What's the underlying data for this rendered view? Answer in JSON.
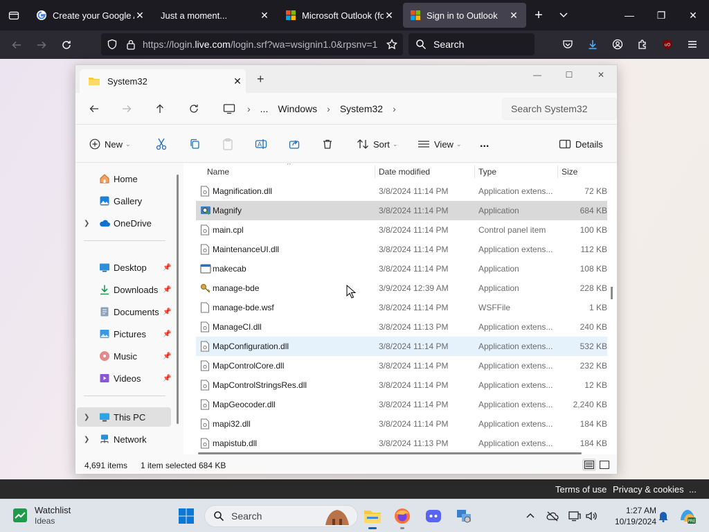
{
  "browser": {
    "tabs": [
      {
        "title": "Create your Google Account",
        "active": false
      },
      {
        "title": "Just a moment...",
        "active": false
      },
      {
        "title": "Microsoft Outlook (formerly Hotmail)",
        "active": false
      },
      {
        "title": "Sign in to Outlook",
        "active": true
      }
    ],
    "url_prefix": "https://login.",
    "url_domain": "live.com",
    "url_suffix": "/login.srf?wa=wsignin1.0&rpsnv=1",
    "search_placeholder": "Search",
    "footer_links": [
      "Terms of use",
      "Privacy & cookies",
      "..."
    ]
  },
  "explorer": {
    "tab_title": "System32",
    "breadcrumbs": [
      "...",
      "Windows",
      "System32"
    ],
    "search_placeholder": "Search System32",
    "toolbar": {
      "new_label": "New",
      "sort_label": "Sort",
      "view_label": "View",
      "more_label": "...",
      "details_label": "Details"
    },
    "nav": {
      "home": "Home",
      "gallery": "Gallery",
      "onedrive": "OneDrive",
      "desktop": "Desktop",
      "downloads": "Downloads",
      "documents": "Documents",
      "pictures": "Pictures",
      "music": "Music",
      "videos": "Videos",
      "this_pc": "This PC",
      "network": "Network"
    },
    "columns": {
      "name": "Name",
      "date": "Date modified",
      "type": "Type",
      "size": "Size"
    },
    "files": [
      {
        "name": "Magnification.dll",
        "date": "3/8/2024 11:14 PM",
        "type": "Application extens...",
        "size": "72 KB",
        "icon": "dll-icon"
      },
      {
        "name": "Magnify",
        "date": "3/8/2024 11:14 PM",
        "type": "Application",
        "size": "684 KB",
        "icon": "magnifier-app-icon"
      },
      {
        "name": "main.cpl",
        "date": "3/8/2024 11:14 PM",
        "type": "Control panel item",
        "size": "100 KB",
        "icon": "cpl-icon"
      },
      {
        "name": "MaintenanceUI.dll",
        "date": "3/8/2024 11:14 PM",
        "type": "Application extens...",
        "size": "112 KB",
        "icon": "dll-icon"
      },
      {
        "name": "makecab",
        "date": "3/8/2024 11:14 PM",
        "type": "Application",
        "size": "108 KB",
        "icon": "exe-icon"
      },
      {
        "name": "manage-bde",
        "date": "3/9/2024 12:39 AM",
        "type": "Application",
        "size": "228 KB",
        "icon": "keys-app-icon"
      },
      {
        "name": "manage-bde.wsf",
        "date": "3/8/2024 11:14 PM",
        "type": "WSFFile",
        "size": "1 KB",
        "icon": "blank-file-icon"
      },
      {
        "name": "ManageCI.dll",
        "date": "3/8/2024 11:13 PM",
        "type": "Application extens...",
        "size": "240 KB",
        "icon": "dll-icon"
      },
      {
        "name": "MapConfiguration.dll",
        "date": "3/8/2024 11:14 PM",
        "type": "Application extens...",
        "size": "532 KB",
        "icon": "dll-icon"
      },
      {
        "name": "MapControlCore.dll",
        "date": "3/8/2024 11:14 PM",
        "type": "Application extens...",
        "size": "232 KB",
        "icon": "dll-icon"
      },
      {
        "name": "MapControlStringsRes.dll",
        "date": "3/8/2024 11:14 PM",
        "type": "Application extens...",
        "size": "12 KB",
        "icon": "dll-icon"
      },
      {
        "name": "MapGeocoder.dll",
        "date": "3/8/2024 11:14 PM",
        "type": "Application extens...",
        "size": "2,240 KB",
        "icon": "dll-icon"
      },
      {
        "name": "mapi32.dll",
        "date": "3/8/2024 11:14 PM",
        "type": "Application extens...",
        "size": "184 KB",
        "icon": "dll-icon"
      },
      {
        "name": "mapistub.dll",
        "date": "3/8/2024 11:13 PM",
        "type": "Application extens...",
        "size": "184 KB",
        "icon": "dll-icon"
      }
    ],
    "status": {
      "items": "4,691 items",
      "selected": "1 item selected",
      "size": "684 KB"
    }
  },
  "taskbar": {
    "widget_title": "Watchlist",
    "widget_subtitle": "Ideas",
    "search_placeholder": "Search",
    "time": "1:27 AM",
    "date": "10/19/2024"
  },
  "colors": {
    "selection": "#cce4f7",
    "accent": "#0067c0",
    "browser_dark": "#1c1b22"
  }
}
